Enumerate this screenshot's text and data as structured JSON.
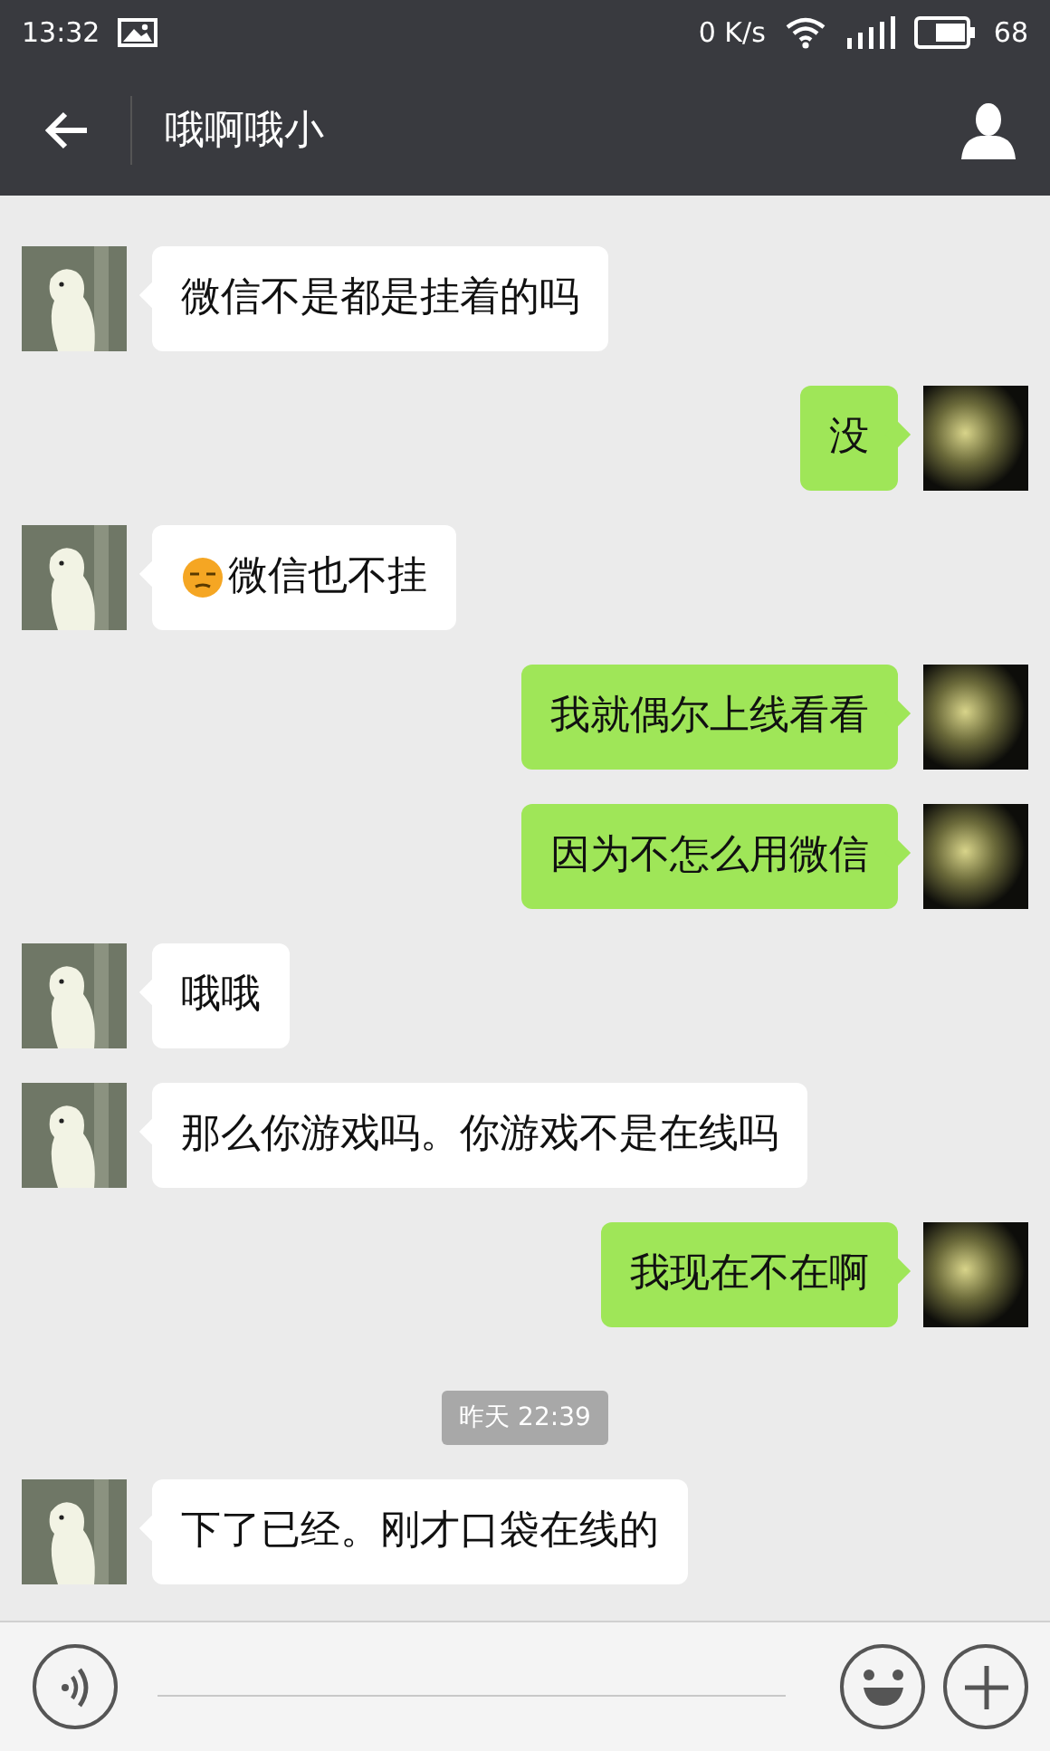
{
  "status_bar": {
    "time": "13:32",
    "speed": "0 K/s",
    "battery": "68"
  },
  "header": {
    "title": "哦啊哦小"
  },
  "messages": [
    {
      "kind": "in",
      "text": "微信不是都是挂着的吗"
    },
    {
      "kind": "out",
      "text": "没"
    },
    {
      "kind": "in",
      "text": "微信也不挂",
      "emoji": true
    },
    {
      "kind": "out",
      "text": "我就偶尔上线看看"
    },
    {
      "kind": "out",
      "text": "因为不怎么用微信"
    },
    {
      "kind": "in",
      "text": "哦哦"
    },
    {
      "kind": "in",
      "text": "那么你游戏吗。你游戏不是在线吗"
    },
    {
      "kind": "out",
      "text": "我现在不在啊"
    },
    {
      "kind": "time",
      "text": "昨天 22:39"
    },
    {
      "kind": "in",
      "text": "下了已经。刚才口袋在线的"
    }
  ]
}
